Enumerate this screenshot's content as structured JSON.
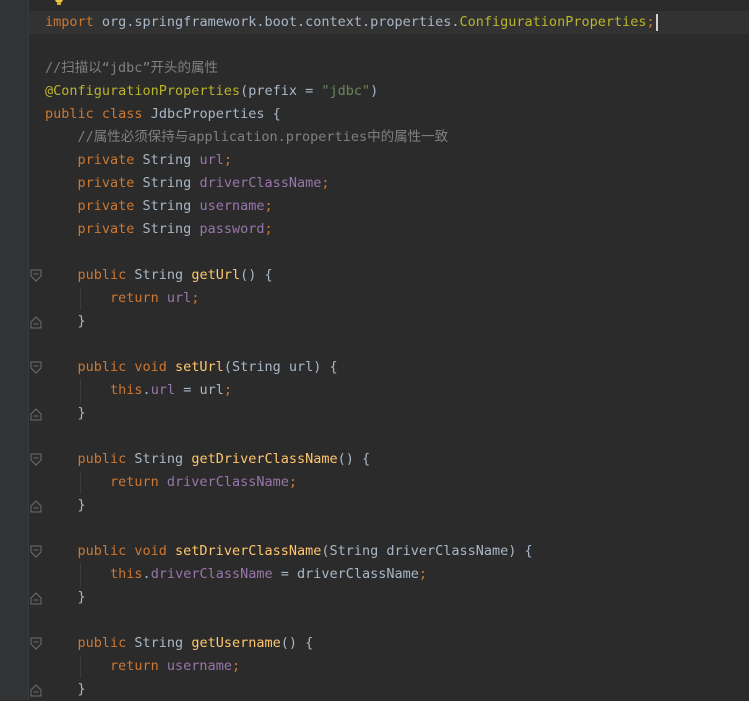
{
  "editor": {
    "colors": {
      "background": "#2b2b2b",
      "gutter": "#313335",
      "keyword": "#cc7832",
      "field": "#9876aa",
      "method": "#ffc66d",
      "annotation": "#bbb529",
      "string": "#6a8759",
      "comment": "#808080",
      "text": "#a9b7c6"
    },
    "lines": [
      {
        "id": "l1",
        "tokens": [
          {
            "t": "import",
            "c": "kw"
          },
          {
            "t": " org.springframework.boot.context.properties.",
            "c": ""
          },
          {
            "t": "ConfigurationProperties",
            "c": "ann"
          },
          {
            "t": ";",
            "c": "kw"
          }
        ],
        "caret": true
      },
      {
        "id": "l2",
        "tokens": []
      },
      {
        "id": "l3",
        "tokens": [
          {
            "t": "//扫描以“jdbc”开头的属性",
            "c": "cm"
          }
        ]
      },
      {
        "id": "l4",
        "tokens": [
          {
            "t": "@ConfigurationProperties",
            "c": "ann"
          },
          {
            "t": "(prefix = ",
            "c": ""
          },
          {
            "t": "\"jdbc\"",
            "c": "str"
          },
          {
            "t": ")",
            "c": ""
          }
        ]
      },
      {
        "id": "l5",
        "tokens": [
          {
            "t": "public ",
            "c": "kw"
          },
          {
            "t": "class ",
            "c": "kw"
          },
          {
            "t": "JdbcProperties {",
            "c": ""
          }
        ]
      },
      {
        "id": "l6",
        "tokens": [
          {
            "t": "    //属性必须保持与application.properties中的属性一致",
            "c": "cm"
          }
        ]
      },
      {
        "id": "l7",
        "tokens": [
          {
            "t": "    private ",
            "c": "kw"
          },
          {
            "t": "String ",
            "c": ""
          },
          {
            "t": "url",
            "c": "fld"
          },
          {
            "t": ";",
            "c": "kw"
          }
        ]
      },
      {
        "id": "l8",
        "tokens": [
          {
            "t": "    private ",
            "c": "kw"
          },
          {
            "t": "String ",
            "c": ""
          },
          {
            "t": "driverClassName",
            "c": "fld"
          },
          {
            "t": ";",
            "c": "kw"
          }
        ]
      },
      {
        "id": "l9",
        "tokens": [
          {
            "t": "    private ",
            "c": "kw"
          },
          {
            "t": "String ",
            "c": ""
          },
          {
            "t": "username",
            "c": "fld"
          },
          {
            "t": ";",
            "c": "kw"
          }
        ]
      },
      {
        "id": "l10",
        "tokens": [
          {
            "t": "    private ",
            "c": "kw"
          },
          {
            "t": "String ",
            "c": ""
          },
          {
            "t": "password",
            "c": "fld"
          },
          {
            "t": ";",
            "c": "kw"
          }
        ]
      },
      {
        "id": "l11",
        "tokens": []
      },
      {
        "id": "l12",
        "tokens": [
          {
            "t": "    public ",
            "c": "kw"
          },
          {
            "t": "String ",
            "c": ""
          },
          {
            "t": "getUrl",
            "c": "fn"
          },
          {
            "t": "() {",
            "c": ""
          }
        ]
      },
      {
        "id": "l13",
        "tokens": [
          {
            "t": "        return ",
            "c": "kw"
          },
          {
            "t": "url",
            "c": "fld"
          },
          {
            "t": ";",
            "c": "kw"
          }
        ]
      },
      {
        "id": "l14",
        "tokens": [
          {
            "t": "    }",
            "c": ""
          }
        ]
      },
      {
        "id": "l15",
        "tokens": []
      },
      {
        "id": "l16",
        "tokens": [
          {
            "t": "    public ",
            "c": "kw"
          },
          {
            "t": "void ",
            "c": "kw"
          },
          {
            "t": "setUrl",
            "c": "fn"
          },
          {
            "t": "(String url) {",
            "c": ""
          }
        ]
      },
      {
        "id": "l17",
        "tokens": [
          {
            "t": "        this",
            "c": "kw"
          },
          {
            "t": ".",
            "c": ""
          },
          {
            "t": "url",
            "c": "fld"
          },
          {
            "t": " = url",
            "c": ""
          },
          {
            "t": ";",
            "c": "kw"
          }
        ]
      },
      {
        "id": "l18",
        "tokens": [
          {
            "t": "    }",
            "c": ""
          }
        ]
      },
      {
        "id": "l19",
        "tokens": []
      },
      {
        "id": "l20",
        "tokens": [
          {
            "t": "    public ",
            "c": "kw"
          },
          {
            "t": "String ",
            "c": ""
          },
          {
            "t": "getDriverClassName",
            "c": "fn"
          },
          {
            "t": "() {",
            "c": ""
          }
        ]
      },
      {
        "id": "l21",
        "tokens": [
          {
            "t": "        return ",
            "c": "kw"
          },
          {
            "t": "driverClassName",
            "c": "fld"
          },
          {
            "t": ";",
            "c": "kw"
          }
        ]
      },
      {
        "id": "l22",
        "tokens": [
          {
            "t": "    }",
            "c": ""
          }
        ]
      },
      {
        "id": "l23",
        "tokens": []
      },
      {
        "id": "l24",
        "tokens": [
          {
            "t": "    public ",
            "c": "kw"
          },
          {
            "t": "void ",
            "c": "kw"
          },
          {
            "t": "setDriverClassName",
            "c": "fn"
          },
          {
            "t": "(String driverClassName) {",
            "c": ""
          }
        ]
      },
      {
        "id": "l25",
        "tokens": [
          {
            "t": "        this",
            "c": "kw"
          },
          {
            "t": ".",
            "c": ""
          },
          {
            "t": "driverClassName",
            "c": "fld"
          },
          {
            "t": " = driverClassName",
            "c": ""
          },
          {
            "t": ";",
            "c": "kw"
          }
        ]
      },
      {
        "id": "l26",
        "tokens": [
          {
            "t": "    }",
            "c": ""
          }
        ]
      },
      {
        "id": "l27",
        "tokens": []
      },
      {
        "id": "l28",
        "tokens": [
          {
            "t": "    public ",
            "c": "kw"
          },
          {
            "t": "String ",
            "c": ""
          },
          {
            "t": "getUsername",
            "c": "fn"
          },
          {
            "t": "() {",
            "c": ""
          }
        ]
      },
      {
        "id": "l29",
        "tokens": [
          {
            "t": "        return ",
            "c": "kw"
          },
          {
            "t": "username",
            "c": "fld"
          },
          {
            "t": ";",
            "c": "kw"
          }
        ]
      },
      {
        "id": "l30",
        "tokens": [
          {
            "t": "    }",
            "c": ""
          }
        ]
      }
    ]
  }
}
